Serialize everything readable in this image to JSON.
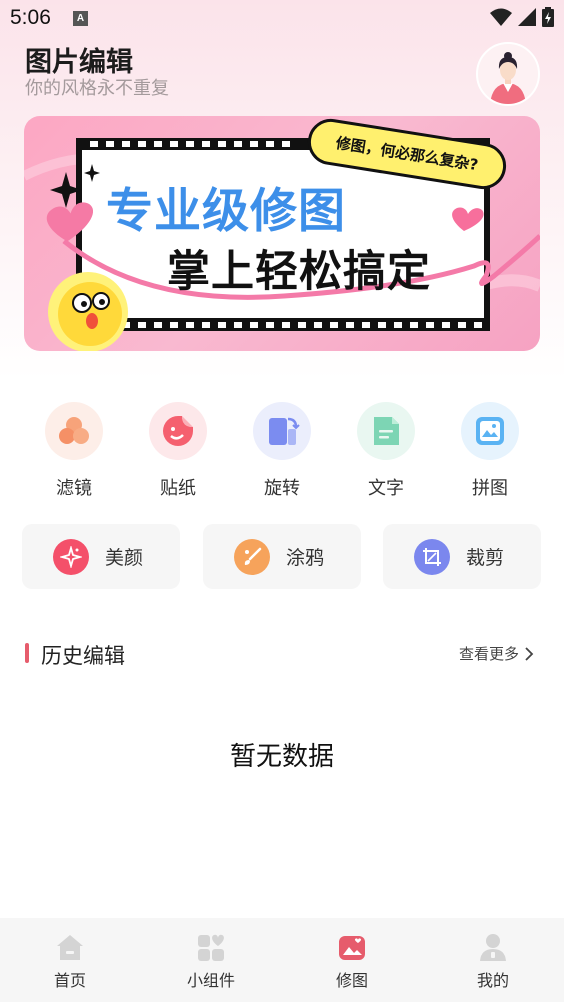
{
  "status_bar": {
    "time": "5:06",
    "notification_letter": "A"
  },
  "header": {
    "title": "图片编辑",
    "subtitle": "你的风格永不重复"
  },
  "banner": {
    "tag": "修图，何必那么复杂?",
    "title_line1": "专业级修图",
    "title_line2": "掌上轻松搞定"
  },
  "tools": [
    {
      "label": "滤镜",
      "icon": "filter-icon",
      "color": "#f59a6a"
    },
    {
      "label": "贴纸",
      "icon": "sticker-icon",
      "color": "#f56a7a"
    },
    {
      "label": "旋转",
      "icon": "rotate-icon",
      "color": "#7b8cf0"
    },
    {
      "label": "文字",
      "icon": "text-icon",
      "color": "#78d3b1"
    },
    {
      "label": "拼图",
      "icon": "collage-icon",
      "color": "#5ab3f3"
    }
  ],
  "cards": [
    {
      "label": "美颜",
      "icon": "beauty-icon",
      "color": "#f4506a"
    },
    {
      "label": "涂鸦",
      "icon": "doodle-icon",
      "color": "#f6a35b"
    },
    {
      "label": "裁剪",
      "icon": "crop-icon",
      "color": "#7b87ee"
    }
  ],
  "history": {
    "title": "历史编辑",
    "more": "查看更多",
    "empty": "暂无数据"
  },
  "nav": [
    {
      "label": "首页",
      "icon": "home-icon"
    },
    {
      "label": "小组件",
      "icon": "widgets-icon"
    },
    {
      "label": "修图",
      "icon": "photo-edit-icon",
      "active": true
    },
    {
      "label": "我的",
      "icon": "profile-icon"
    }
  ],
  "colors": {
    "accent": "#e65c6c",
    "background_top": "#fbe3ea"
  }
}
